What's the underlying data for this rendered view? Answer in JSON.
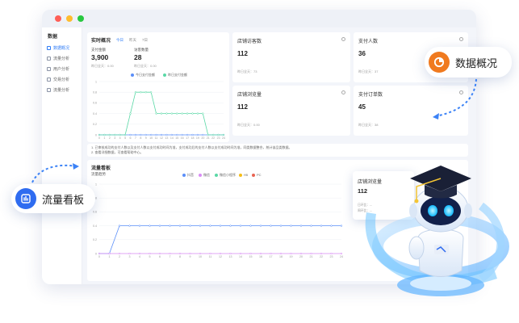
{
  "sidebar": {
    "title": "数据",
    "items": [
      {
        "label": "数据概况",
        "active": true
      },
      {
        "label": "流量分析",
        "active": false
      },
      {
        "label": "用户分析",
        "active": false
      },
      {
        "label": "交易分析",
        "active": false
      },
      {
        "label": "流量分析",
        "active": false
      }
    ]
  },
  "realtime": {
    "title": "实时概况",
    "tabs": [
      "今日",
      "昨天",
      "7日"
    ],
    "metrics": [
      {
        "label": "支付金额",
        "value": "3,900",
        "sub": "昨日全天：0.00"
      },
      {
        "label": "访客数量",
        "value": "28",
        "sub": "昨日全天：0.00"
      }
    ],
    "legend": [
      "今日支付金额",
      "昨日支付金额"
    ]
  },
  "cards": [
    {
      "title": "店铺访客数",
      "value": "112",
      "sub": "昨日全天：73"
    },
    {
      "title": "支付人数",
      "value": "36",
      "sub": "昨日全天：37"
    },
    {
      "title": "店铺浏览量",
      "value": "112",
      "sub": "昨日全天：0.00"
    },
    {
      "title": "支付订单数",
      "value": "45",
      "sub": "昨日全天：38"
    }
  ],
  "notes": [
    "1. 已审核成功的支付人数以及支付人数以支付成功时间为准，支付成功后的支付人数以支付成功时间为准，同类数据整合，统计该品类数据。",
    "2. 查看详细数据，可查看帮助中心。"
  ],
  "flow": {
    "title": "流量看板",
    "subtitle": "流量趋势",
    "legend": [
      "抖音",
      "微信",
      "微信小程序",
      "H5",
      "PC"
    ],
    "legend_colors": [
      "#5b8ff9",
      "#d98cf5",
      "#5ad8a6",
      "#f6bd16",
      "#e86452"
    ]
  },
  "float_card": {
    "title": "店铺浏览量",
    "value": "112",
    "lines": [
      "日环比：--",
      "周环比：--"
    ]
  },
  "callouts": {
    "overview": "数据概况",
    "flow": "流量看板"
  },
  "chart_data": [
    {
      "type": "line",
      "x": [
        0,
        1,
        2,
        3,
        4,
        5,
        6,
        7,
        8,
        9,
        10,
        11,
        12,
        13,
        14,
        15,
        16,
        17,
        18,
        19,
        20,
        21,
        22,
        23,
        24
      ],
      "ylim": [
        0,
        1
      ],
      "yticks": [
        0,
        0.2,
        0.4,
        0.6,
        0.8,
        1
      ],
      "series": [
        {
          "name": "今日支付金额",
          "color": "#5b8ff9",
          "values": [
            0,
            0,
            0,
            0,
            0,
            0,
            0,
            0,
            0,
            0,
            0,
            0,
            0,
            0,
            0,
            0,
            0,
            0,
            0,
            0,
            0,
            0,
            0,
            0,
            0
          ]
        },
        {
          "name": "昨日支付金额",
          "color": "#5ad8a6",
          "values": [
            0,
            0,
            0,
            0,
            0,
            0,
            0.4,
            0.8,
            0.8,
            0.8,
            0.8,
            0.4,
            0.4,
            0.4,
            0.4,
            0.4,
            0.4,
            0.4,
            0.4,
            0.4,
            0.4,
            0,
            0,
            0,
            0
          ]
        }
      ]
    },
    {
      "type": "line",
      "x": [
        0,
        1,
        2,
        3,
        4,
        5,
        6,
        7,
        8,
        9,
        10,
        11,
        12,
        13,
        14,
        15,
        16,
        17,
        18,
        19,
        20,
        21,
        22,
        23,
        24
      ],
      "ylim": [
        0,
        1
      ],
      "yticks": [
        0,
        0.2,
        0.4,
        0.6,
        0.8,
        1
      ],
      "series": [
        {
          "name": "抖音",
          "color": "#5b8ff9",
          "values": [
            0,
            0,
            0.4,
            0.4,
            0.4,
            0.4,
            0.4,
            0.4,
            0.4,
            0.4,
            0.4,
            0.4,
            0.4,
            0.4,
            0.4,
            0.4,
            0.4,
            0.4,
            0.4,
            0.4,
            0.4,
            0.4,
            0.4,
            0.4,
            0.4
          ]
        },
        {
          "name": "微信",
          "color": "#d98cf5",
          "values": [
            0,
            0,
            0,
            0,
            0,
            0,
            0,
            0,
            0,
            0,
            0,
            0,
            0,
            0,
            0,
            0,
            0,
            0,
            0,
            0,
            0,
            0,
            0,
            0,
            0
          ]
        }
      ]
    }
  ]
}
